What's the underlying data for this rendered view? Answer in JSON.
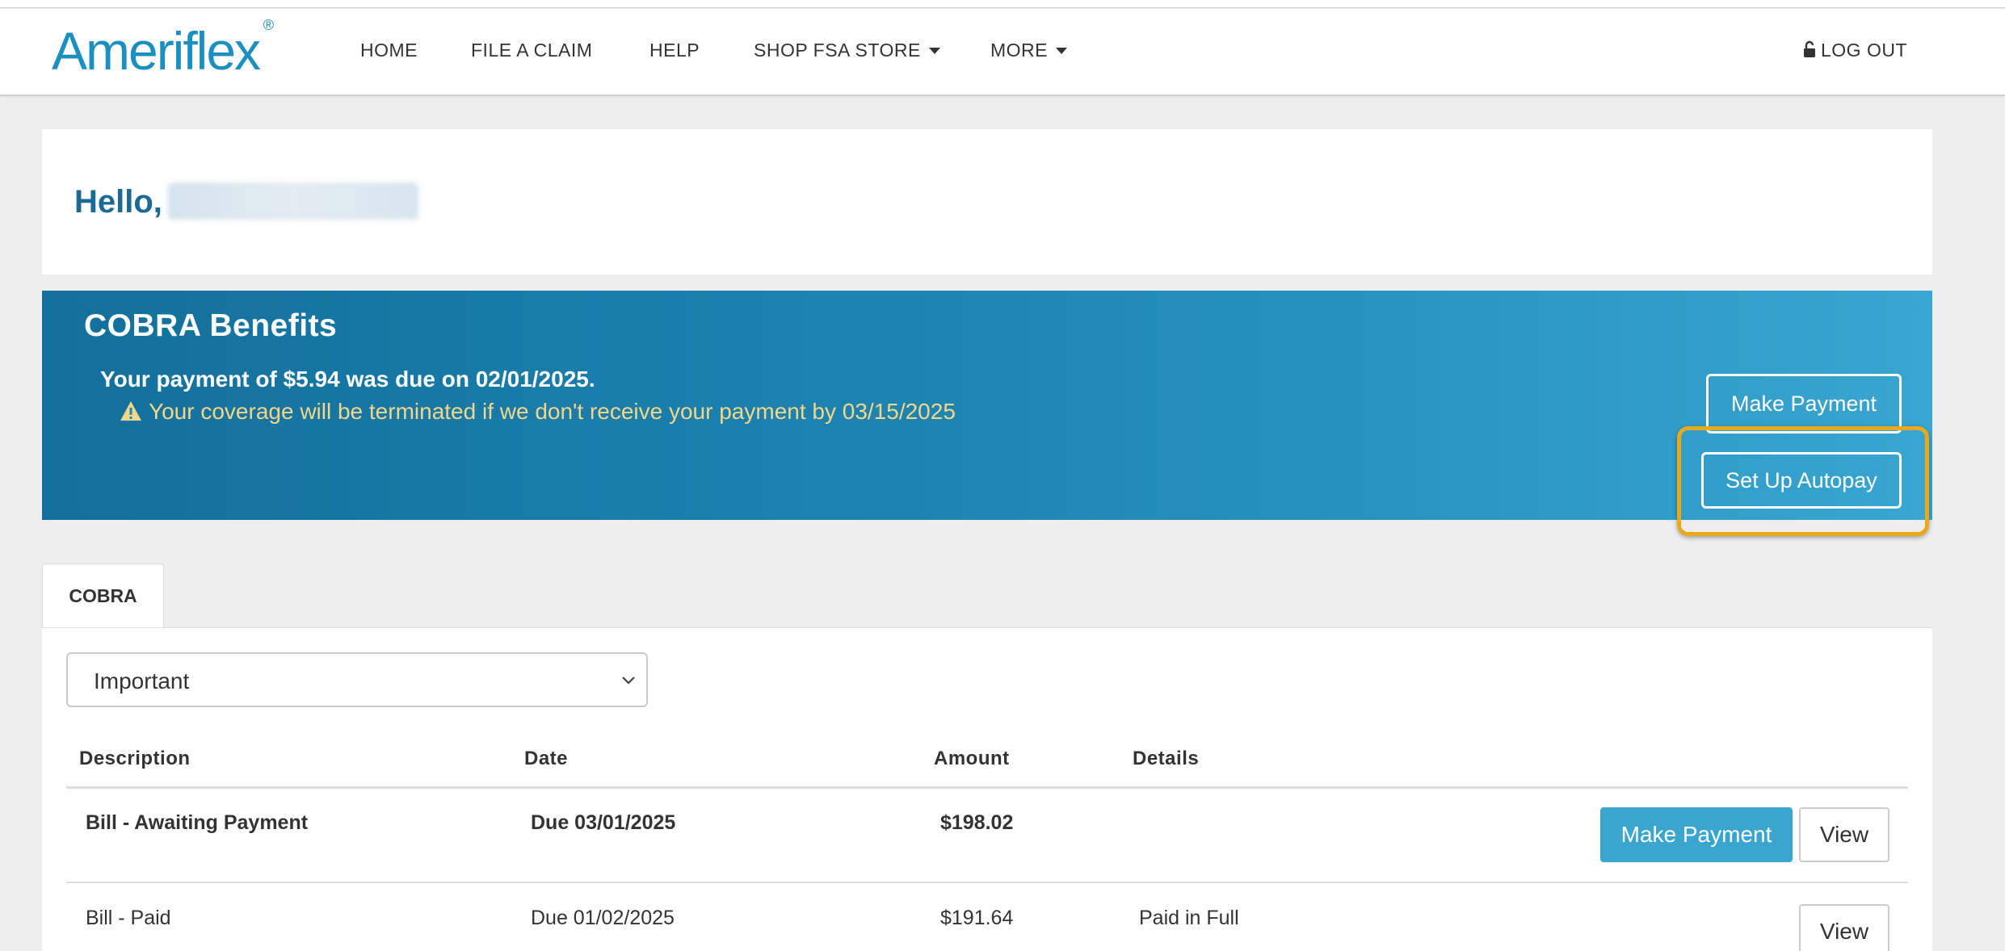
{
  "brand": {
    "name": "Ameriflex",
    "registered": "®"
  },
  "nav": {
    "home": "HOME",
    "file_claim": "FILE A CLAIM",
    "help": "HELP",
    "shop": "SHOP FSA STORE",
    "more": "MORE",
    "logout": "LOG OUT"
  },
  "greeting": {
    "hello": "Hello,"
  },
  "banner": {
    "title": "COBRA Benefits",
    "due_message": "Your payment of $5.94 was due on 02/01/2025.",
    "warning": "Your coverage will be terminated if we don't receive your payment by 03/15/2025",
    "make_payment": "Make Payment",
    "autopay": "Set Up Autopay"
  },
  "tabs": [
    {
      "label": "COBRA"
    }
  ],
  "filter": {
    "selected": "Important"
  },
  "table": {
    "headers": [
      "Description",
      "Date",
      "Amount",
      "Details"
    ],
    "rows": [
      {
        "description": "Bill - Awaiting Payment",
        "date": "Due 03/01/2025",
        "amount": "$198.02",
        "details": "",
        "pay_label": "Make Payment",
        "view_label": "View"
      },
      {
        "description": "Bill - Paid",
        "date": "Due 01/02/2025",
        "amount": "$191.64",
        "details": "Paid in Full",
        "view_label": "View"
      }
    ]
  },
  "colors": {
    "brand": "#1b8fc0",
    "banner_start": "#136f9b",
    "banner_end": "#38a6d0",
    "warning": "#f2d68a",
    "highlight": "#e8aa1c",
    "primary_button": "#3aa6cf"
  }
}
